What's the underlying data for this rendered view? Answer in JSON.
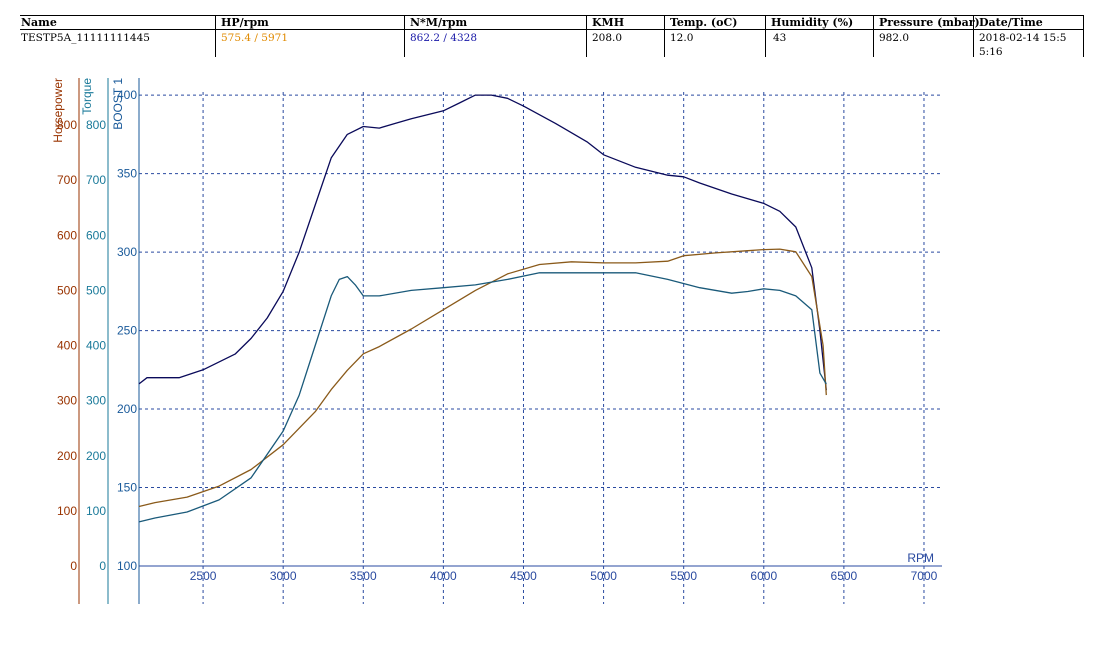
{
  "header": {
    "columns": [
      {
        "label": "Name",
        "value": "TESTP5A_11111111445",
        "color": "#000000"
      },
      {
        "label": "HP/rpm",
        "value": "575.4 / 5971",
        "color": "#e08a00"
      },
      {
        "label": "N*M/rpm",
        "value": "862.2 / 4328",
        "color": "#1a1aa8"
      },
      {
        "label": "KMH",
        "value": "208.0",
        "color": "#000000"
      },
      {
        "label": "Temp. (oC)",
        "value": "12.0",
        "color": "#000000"
      },
      {
        "label": "Humidity (%)",
        "value": "43",
        "color": "#000000"
      },
      {
        "label": "Pressure (mbar)",
        "value": "982.0",
        "color": "#000000"
      },
      {
        "label": "Date/Time",
        "value": "2018-02-14 15:55:16",
        "color": "#000000"
      }
    ]
  },
  "chart_data": {
    "type": "line",
    "xlabel": "RPM",
    "xlim": [
      2100,
      7100
    ],
    "x_ticks": [
      2500,
      3000,
      3500,
      4000,
      4500,
      5000,
      5500,
      6000,
      6500,
      7000
    ],
    "axes": [
      {
        "label": "Horsepower",
        "color": "#993300",
        "ticks": [
          0,
          100,
          200,
          300,
          400,
          500,
          600,
          700,
          800
        ]
      },
      {
        "label": "Torque",
        "color": "#1a7a9a",
        "ticks": [
          0,
          100,
          200,
          300,
          400,
          500,
          600,
          700,
          800
        ]
      },
      {
        "label": "BOOST 1",
        "color": "#1a5a9a",
        "ticks": [
          100,
          150,
          200,
          250,
          300,
          350,
          400
        ]
      }
    ],
    "ylim_horsepower": [
      0,
      860
    ],
    "ylim_boost": [
      100,
      402
    ],
    "grid": true,
    "series": [
      {
        "axis": "boost",
        "color": "#0a0a5a",
        "x": [
          2100,
          2150,
          2350,
          2500,
          2700,
          2800,
          2900,
          3000,
          3100,
          3200,
          3300,
          3400,
          3500,
          3600,
          3700,
          3800,
          4000,
          4100,
          4200,
          4300,
          4400,
          4500,
          4700,
          4900,
          5000,
          5200,
          5400,
          5500,
          5600,
          5800,
          6000,
          6100,
          6200,
          6300,
          6350,
          6390
        ],
        "values": [
          216,
          220,
          220,
          225,
          235,
          245,
          258,
          275,
          300,
          330,
          360,
          375,
          380,
          379,
          382,
          385,
          390,
          395,
          400,
          400,
          398,
          393,
          382,
          370,
          362,
          354,
          349,
          348,
          344,
          337,
          331,
          326,
          316,
          290,
          250,
          212
        ]
      },
      {
        "axis": "horsepower",
        "color": "#8a5a1a",
        "x": [
          2100,
          2200,
          2400,
          2600,
          2800,
          3000,
          3200,
          3300,
          3400,
          3500,
          3600,
          3800,
          4000,
          4200,
          4400,
          4600,
          4800,
          5000,
          5200,
          5400,
          5500,
          5700,
          5900,
          6000,
          6100,
          6200,
          6300,
          6370,
          6390
        ],
        "values": [
          108,
          115,
          125,
          145,
          175,
          220,
          280,
          320,
          355,
          385,
          398,
          430,
          465,
          500,
          530,
          547,
          552,
          550,
          550,
          553,
          563,
          568,
          572,
          574,
          575,
          570,
          525,
          400,
          310
        ]
      },
      {
        "axis": "horsepower",
        "color": "#1a5a7a",
        "x": [
          2100,
          2200,
          2400,
          2600,
          2800,
          3000,
          3100,
          3200,
          3300,
          3350,
          3400,
          3450,
          3500,
          3600,
          3800,
          4000,
          4200,
          4400,
          4600,
          4800,
          5000,
          5200,
          5400,
          5600,
          5800,
          5900,
          6000,
          6100,
          6200,
          6300,
          6350,
          6390
        ],
        "values": [
          80,
          87,
          98,
          120,
          160,
          245,
          310,
          400,
          490,
          520,
          525,
          510,
          490,
          490,
          500,
          505,
          510,
          520,
          532,
          532,
          532,
          532,
          520,
          505,
          495,
          498,
          503,
          500,
          490,
          465,
          350,
          330
        ]
      }
    ]
  }
}
